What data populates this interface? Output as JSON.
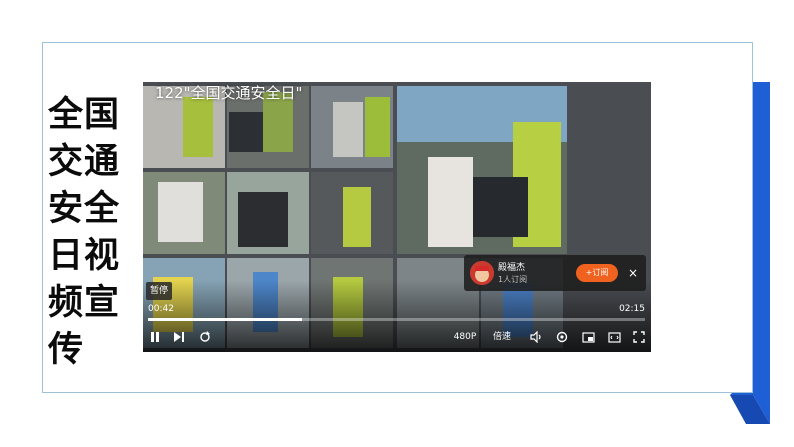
{
  "slide": {
    "title": "全国交通安全日视频宣传",
    "accent_color": "#1f5fd6"
  },
  "player": {
    "video_title_overlay": "122\"全国交通安全日\"",
    "watermark": "",
    "pause_tooltip": "暂停",
    "current_time": "00:42",
    "total_time": "02:15",
    "progress_fraction": 0.31,
    "quality_label": "480P",
    "speed_label": "倍速",
    "subscribe_card": {
      "channel_name": "殿福杰",
      "subscriber_count": "1人订阅",
      "subscribe_label": "+订阅",
      "close_label": "×"
    },
    "icons": {
      "pause": "pause-icon",
      "next": "next-icon",
      "loop": "loop-icon",
      "volume": "volume-icon",
      "settings": "settings-icon",
      "pip": "pip-icon",
      "widescreen": "widescreen-icon",
      "fullscreen": "fullscreen-icon"
    }
  }
}
